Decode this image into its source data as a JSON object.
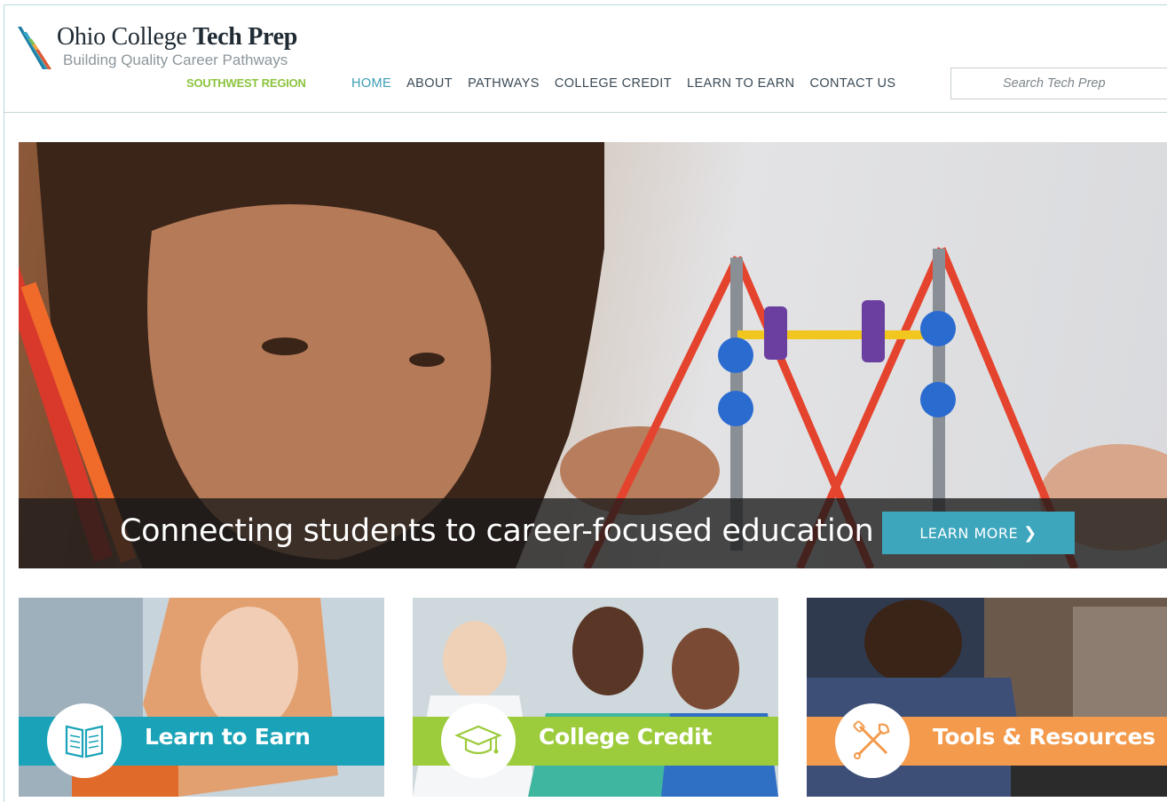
{
  "brand": {
    "title_regular": "Ohio College ",
    "title_bold": "Tech Prep",
    "tagline": "Building Quality Career Pathways",
    "region": "SOUTHWEST REGION"
  },
  "nav": {
    "items": [
      {
        "label": "HOME",
        "active": true
      },
      {
        "label": "ABOUT",
        "active": false
      },
      {
        "label": "PATHWAYS",
        "active": false
      },
      {
        "label": "COLLEGE CREDIT",
        "active": false
      },
      {
        "label": "LEARN TO EARN",
        "active": false
      },
      {
        "label": "CONTACT US",
        "active": false
      }
    ]
  },
  "search": {
    "placeholder": "Search Tech Prep",
    "value": ""
  },
  "hero": {
    "caption": "Connecting students to career-focused education",
    "button_label": "LEARN MORE"
  },
  "cards": [
    {
      "label": "Learn to Earn",
      "icon": "open-book-icon",
      "color": "#1aa3b8"
    },
    {
      "label": "College Credit",
      "icon": "graduation-cap-icon",
      "color": "#9ccb3b"
    },
    {
      "label": "Tools & Resources",
      "icon": "tools-icon",
      "color": "#f39a4c"
    }
  ],
  "colors": {
    "accent": "#3c9db3",
    "nav_text": "#3a4a55",
    "region_green": "#8cc43f",
    "button": "#3da6bd"
  }
}
